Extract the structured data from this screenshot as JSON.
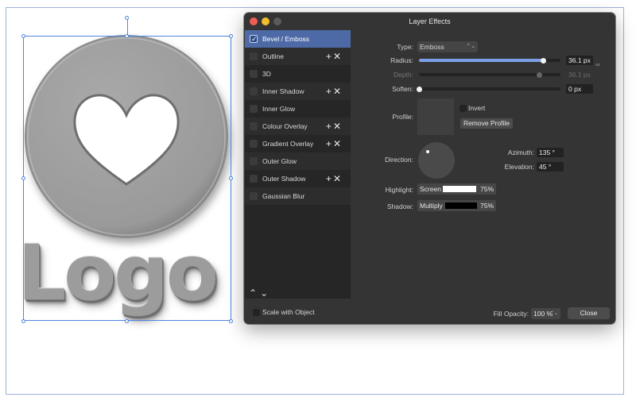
{
  "canvas": {
    "logo_text": "Logo"
  },
  "dialog": {
    "title": "Layer Effects",
    "effects": [
      {
        "label": "Bevel / Emboss",
        "selected": true,
        "checked": true,
        "actions": false
      },
      {
        "label": "Outline",
        "selected": false,
        "checked": false,
        "actions": true
      },
      {
        "label": "3D",
        "selected": false,
        "checked": false,
        "actions": false
      },
      {
        "label": "Inner Shadow",
        "selected": false,
        "checked": false,
        "actions": true
      },
      {
        "label": "Inner Glow",
        "selected": false,
        "checked": false,
        "actions": false
      },
      {
        "label": "Colour Overlay",
        "selected": false,
        "checked": false,
        "actions": true
      },
      {
        "label": "Gradient Overlay",
        "selected": false,
        "checked": false,
        "actions": true
      },
      {
        "label": "Outer Glow",
        "selected": false,
        "checked": false,
        "actions": false
      },
      {
        "label": "Outer Shadow",
        "selected": false,
        "checked": false,
        "actions": true
      },
      {
        "label": "Gaussian Blur",
        "selected": false,
        "checked": false,
        "actions": false
      }
    ],
    "glyphs": {
      "plus": "+",
      "remove": "✕",
      "up": "⌃",
      "down": "⌄",
      "tick": "✓",
      "chevron": "⌃⌄",
      "link": "∞"
    },
    "type": {
      "label": "Type:",
      "value": "Emboss"
    },
    "radius": {
      "label": "Radius:",
      "value": "36.1 px",
      "fraction": 0.88
    },
    "depth": {
      "label": "Depth:",
      "value": "36.1 px",
      "fraction": 0.85
    },
    "soften": {
      "label": "Soften:",
      "value": "0 px",
      "fraction": 0.0
    },
    "profile": {
      "label": "Profile:",
      "invert_label": "Invert",
      "remove_button": "Remove Profile"
    },
    "direction": {
      "label": "Direction:"
    },
    "azimuth": {
      "label": "Azimuth:",
      "value": "135 °"
    },
    "elevation": {
      "label": "Elevation:",
      "value": "45 °"
    },
    "highlight": {
      "label": "Highlight:",
      "mode": "Screen",
      "opacity": "75%",
      "color": "#ffffff"
    },
    "shadow": {
      "label": "Shadow:",
      "mode": "Multiply",
      "opacity": "75%",
      "color": "#000000"
    },
    "scale_with_object": "Scale with Object",
    "fill_opacity": {
      "label": "Fill Opacity:",
      "value": "100 %"
    },
    "close_button": "Close"
  },
  "colors": {
    "accent": "#4d6aa6",
    "slider_fill": "#7ba0e8",
    "selection": "#4d86e0"
  }
}
